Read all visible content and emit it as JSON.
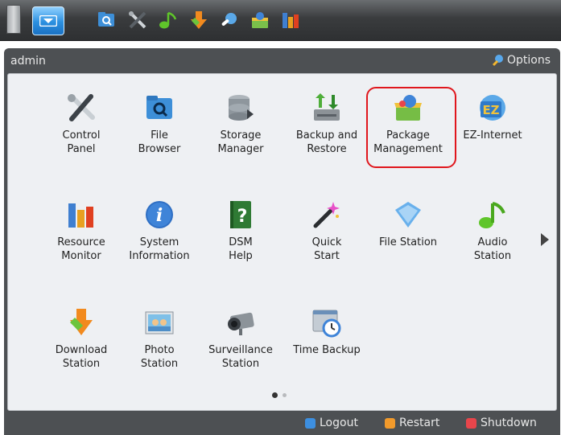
{
  "session": {
    "user": "admin",
    "options_label": "Options"
  },
  "taskbar": {
    "icons": [
      "file-browser-icon",
      "control-panel-icon",
      "audio-station-icon",
      "download-station-icon",
      "quick-start-icon",
      "package-management-icon",
      "resource-monitor-icon"
    ]
  },
  "apps": [
    {
      "label": "Control\nPanel",
      "icon": "control-panel-icon"
    },
    {
      "label": "File\nBrowser",
      "icon": "file-browser-icon"
    },
    {
      "label": "Storage\nManager",
      "icon": "storage-manager-icon"
    },
    {
      "label": "Backup and\nRestore",
      "icon": "backup-restore-icon"
    },
    {
      "label": "Package\nManagement",
      "icon": "package-management-icon"
    },
    {
      "label": "EZ-Internet",
      "icon": "ez-internet-icon"
    },
    {
      "label": "Resource\nMonitor",
      "icon": "resource-monitor-icon"
    },
    {
      "label": "System\nInformation",
      "icon": "system-information-icon"
    },
    {
      "label": "DSM\nHelp",
      "icon": "dsm-help-icon"
    },
    {
      "label": "Quick\nStart",
      "icon": "quick-start-icon"
    },
    {
      "label": "File Station",
      "icon": "file-station-icon"
    },
    {
      "label": "Audio\nStation",
      "icon": "audio-station-icon"
    },
    {
      "label": "Download\nStation",
      "icon": "download-station-icon"
    },
    {
      "label": "Photo\nStation",
      "icon": "photo-station-icon"
    },
    {
      "label": "Surveillance\nStation",
      "icon": "surveillance-station-icon"
    },
    {
      "label": "Time Backup",
      "icon": "time-backup-icon"
    }
  ],
  "pager": {
    "pages": 2,
    "current": 1
  },
  "footer": {
    "logout": "Logout",
    "restart": "Restart",
    "shutdown": "Shutdown"
  },
  "colors": {
    "accent": "#2b8fe0",
    "highlight": "#e0161c",
    "logout": "#3d8fe0",
    "restart": "#f29a2b",
    "shutdown": "#e8454b"
  }
}
